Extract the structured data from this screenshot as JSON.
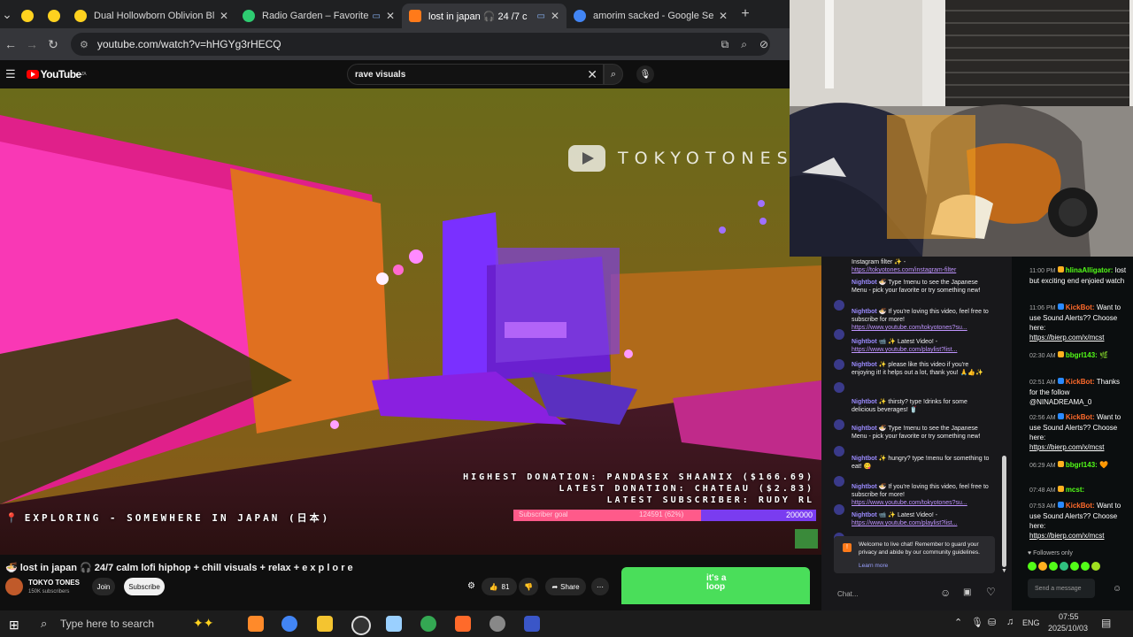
{
  "browser": {
    "tabs": [
      {
        "title": "",
        "color": "#ffd21f",
        "close": ""
      },
      {
        "title": "",
        "color": "#ffd21f",
        "close": ""
      },
      {
        "title": "Dual Hollowborn Oblivion Blad",
        "color": "#ffd21f",
        "close": "✕"
      },
      {
        "title": "Radio Garden – Favorites",
        "color": "#2ecc71",
        "close": "✕"
      },
      {
        "title": "lost in japan 🎧 24 /7 c",
        "color": "#ff7a1a",
        "close": "✕"
      },
      {
        "title": "amorim sacked - Google Searc",
        "color": "#4285f4",
        "close": "✕"
      }
    ],
    "url": "youtube.com/watch?v=hHGYg3rHECQ"
  },
  "youtube": {
    "logo_text": "YouTube",
    "logo_sup": "ZA",
    "search_value": "rave visuals"
  },
  "video": {
    "watermark": "TOKYOTONES",
    "highest_donation": "HIGHEST DONATION: PANDASEX SHAANIX  ($166.69)",
    "latest_donation": "LATEST DONATION: CHATEAU ($2.83)",
    "latest_subscriber": "LATEST SUBSCRIBER: RUDY RL",
    "exploring": "EXPLORING - SOMEWHERE IN JAPAN (日本)",
    "sub_goal_label": "Subscriber goal",
    "sub_goal_progress": "124591 (62%)",
    "sub_goal_fraction": 0.62,
    "sub_goal_target": "200000"
  },
  "info": {
    "title": "🍜 lost in japan 🎧 24/7 calm lofi hiphop + chill visuals + relax + e x p l o r e",
    "channel": "TOKYO TONES",
    "subs": "150K subscribers",
    "join": "Join",
    "subscribe": "Subscribe",
    "likes": "81",
    "share": "Share",
    "ad_text": "it's a loop"
  },
  "chat": {
    "messages": [
      {
        "name": "",
        "text": "Instagram filter ✨ -",
        "link": "https://tokyotones.com/instagram-filter"
      },
      {
        "name": "Nightbot",
        "text": "🍜 Type !menu to see the Japanese Menu - pick your favorite or try something new!",
        "link": ""
      },
      {
        "name": "Nightbot",
        "text": "🍜 If you're loving this video, feel free to subscribe for more!",
        "link": "https://www.youtube.com/tokyotones?su..."
      },
      {
        "name": "Nightbot",
        "text": "📹 ✨ Latest Video! -",
        "link": "https://www.youtube.com/playlist?list..."
      },
      {
        "name": "Nightbot",
        "text": "✨ please like this video if you're enjoying it! it helps out a lot, thank you! 🙏👍✨",
        "link": ""
      },
      {
        "name": "Nightbot",
        "text": "✨ thirsty? type !drinks for some delicious beverages! 🥤",
        "link": ""
      },
      {
        "name": "Nightbot",
        "text": "🍜 Type !menu to see the Japanese Menu - pick your favorite or try something new!",
        "link": ""
      },
      {
        "name": "Nightbot",
        "text": "✨ hungry? type !menu for something to eat! 😋",
        "link": ""
      },
      {
        "name": "Nightbot",
        "text": "🍜 If you're loving this video, feel free to subscribe for more!",
        "link": "https://www.youtube.com/tokyotones?su..."
      },
      {
        "name": "Nightbot",
        "text": "📹 ✨ Latest Video! -",
        "link": "https://www.youtube.com/playlist?list..."
      }
    ],
    "notice": "Welcome to live chat! Remember to guard your privacy and abide by our community guidelines.",
    "learn_more": "Learn more",
    "placeholder": "Chat..."
  },
  "kick": {
    "messages": [
      {
        "time": "11:00 PM",
        "user": "hlinaAlligator:",
        "text": "lost but exciting end enjoied watch",
        "link": "",
        "bot": false
      },
      {
        "time": "11:06 PM",
        "user": "KickBot:",
        "text": "Want to use Sound Alerts?? Choose here:",
        "link": "https://bierp.com/x/mcst",
        "bot": true
      },
      {
        "time": "02:30 AM",
        "user": "bbgrl143:",
        "text": "🌿",
        "link": "",
        "bot": false
      },
      {
        "time": "02:51 AM",
        "user": "KickBot:",
        "text": "Thanks for the follow @NINADREAMA_0",
        "link": "",
        "bot": true
      },
      {
        "time": "02:56 AM",
        "user": "KickBot:",
        "text": "Want to use Sound Alerts?? Choose here:",
        "link": "https://bierp.com/x/mcst",
        "bot": true
      },
      {
        "time": "06:29 AM",
        "user": "bbgrl143:",
        "text": "🧡",
        "link": "",
        "bot": false
      },
      {
        "time": "07:48 AM",
        "user": "mcst:",
        "text": "",
        "link": "",
        "bot": false
      },
      {
        "time": "07:53 AM",
        "user": "KickBot:",
        "text": "Want to use Sound Alerts?? Choose here:",
        "link": "https://bierp.com/x/mcst",
        "bot": true
      }
    ],
    "followers_only": "Followers only",
    "send_placeholder": "Send a message"
  },
  "taskbar": {
    "search_placeholder": "Type here to search",
    "lang": "ENG",
    "time": "07:55",
    "date": "2025/10/03"
  }
}
